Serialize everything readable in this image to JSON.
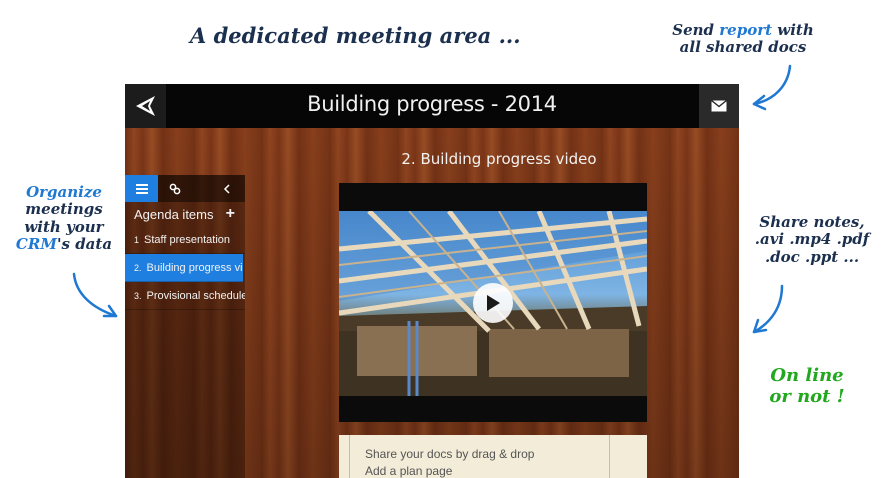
{
  "annotations": {
    "headline": "A dedicated meeting area ...",
    "report_prefix": "Send",
    "report_highlight": "report",
    "report_suffix": "with",
    "report_line2": "all shared docs",
    "organize_line1": "Organize",
    "organize_line2": "meetings",
    "organize_line3": "with your",
    "organize_crm": "CRM",
    "organize_suffix": "'s data",
    "share_line1": "Share notes,",
    "share_line2": ".avi .mp4 .pdf",
    "share_line3": ".doc .ppt ...",
    "online_line1": "On line",
    "online_line2": "or not !"
  },
  "app": {
    "title": "Building progress - 2014",
    "logo_icon": "app-logo-icon",
    "mail_icon": "envelope-icon"
  },
  "sidebar": {
    "tabs": [
      {
        "icon": "list-icon",
        "active": true
      },
      {
        "icon": "link-icon",
        "active": false
      },
      {
        "icon": "chevron-left-icon",
        "active": false
      }
    ],
    "agenda_label": "Agenda items",
    "add_symbol": "+",
    "items": [
      {
        "num": "1",
        "label": "Staff presentation",
        "active": false
      },
      {
        "num": "2.",
        "label": "Building progress vid ...",
        "active": true
      },
      {
        "num": "3.",
        "label": "Provisional schedule",
        "active": false
      }
    ]
  },
  "main": {
    "section_title": "2. Building progress video",
    "notes": [
      "Share your docs by drag & drop",
      "Add a plan page"
    ]
  },
  "colors": {
    "accent": "#1f7fe0",
    "annotation_dark": "#1b2f4e",
    "annotation_blue": "#1f78d1",
    "annotation_green": "#22a81e"
  }
}
